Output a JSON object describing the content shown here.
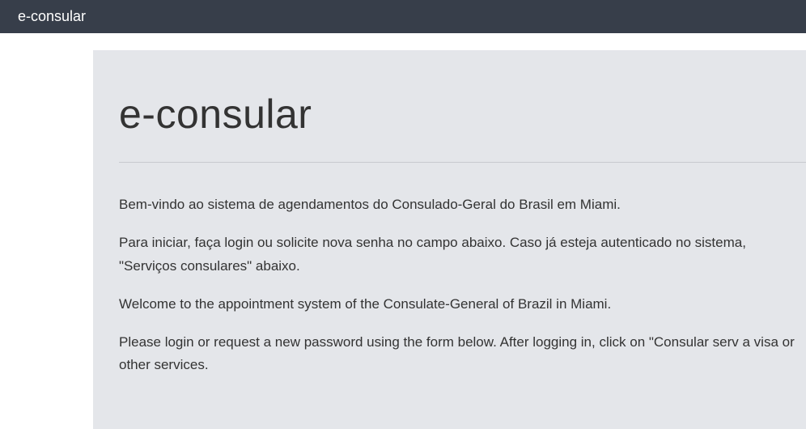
{
  "header": {
    "title": "e-consular"
  },
  "main": {
    "heading": "e-consular",
    "paragraphs": [
      "Bem-vindo ao sistema de agendamentos do Consulado-Geral do Brasil em Miami.",
      "Para iniciar, faça login ou solicite nova senha no campo abaixo. Caso já esteja autenticado no sistema, \"Serviços consulares\" abaixo.",
      "Welcome to the appointment system of the Consulate-General of Brazil in Miami.",
      "Please login or request a new password using the form below. After logging in, click on \"Consular serv a visa or other services."
    ]
  }
}
